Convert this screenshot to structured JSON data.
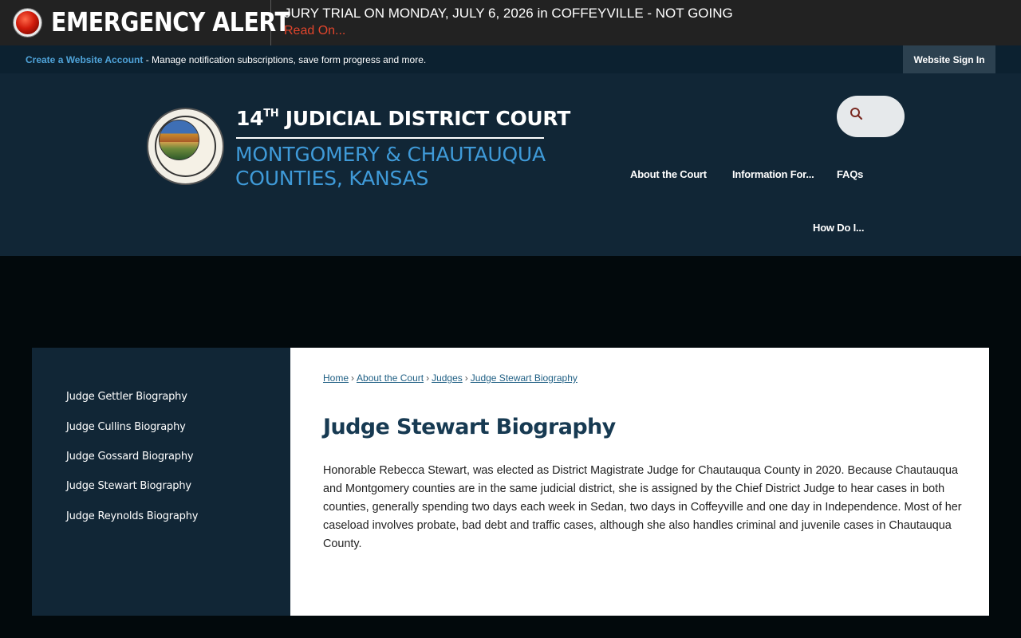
{
  "alert": {
    "title": "EMERGENCY ALERT",
    "message": "JURY TRIAL ON MONDAY, JULY 6, 2026 in COFFEYVILLE - NOT GOING",
    "read_on": "Read On...",
    "accent_color": "#e2452c"
  },
  "account": {
    "create_link": "Create a Website Account",
    "description": " - Manage notification subscriptions, save form progress and more.",
    "signin": "Website Sign In"
  },
  "header": {
    "logo_prefix": "14",
    "logo_sup": "TH",
    "logo_line1": " JUDICIAL DISTRICT COURT",
    "logo_line2a": "MONTGOMERY & CHAUTAUQUA",
    "logo_line2b": "COUNTIES, KANSAS",
    "nav": [
      "About the Court",
      "Information For...",
      "FAQs",
      "How Do I..."
    ]
  },
  "sidebar": {
    "items": [
      "Judge Gettler Biography",
      "Judge Cullins Biography",
      "Judge Gossard Biography",
      "Judge Stewart Biography",
      "Judge Reynolds Biography"
    ]
  },
  "main": {
    "breadcrumb": [
      "Home",
      "About the Court",
      "Judges",
      "Judge Stewart Biography"
    ],
    "breadcrumb_sep": "›",
    "title": "Judge Stewart Biography",
    "body": "Honorable Rebecca Stewart, was elected as District Magistrate Judge for Chautauqua County in 2020.  Because Chautauqua and Montgomery counties are in the same judicial district, she is assigned by the Chief District Judge to hear cases in both counties, generally spending two days each week in Sedan, two days in Coffeyville and one day in Independence. Most of her caseload involves probate, bad debt and traffic cases, although she also handles criminal and juvenile cases in Chautauqua County."
  },
  "colors": {
    "header_bg": "#112636",
    "link_blue": "#4fa3d9",
    "title_color": "#173a52"
  }
}
